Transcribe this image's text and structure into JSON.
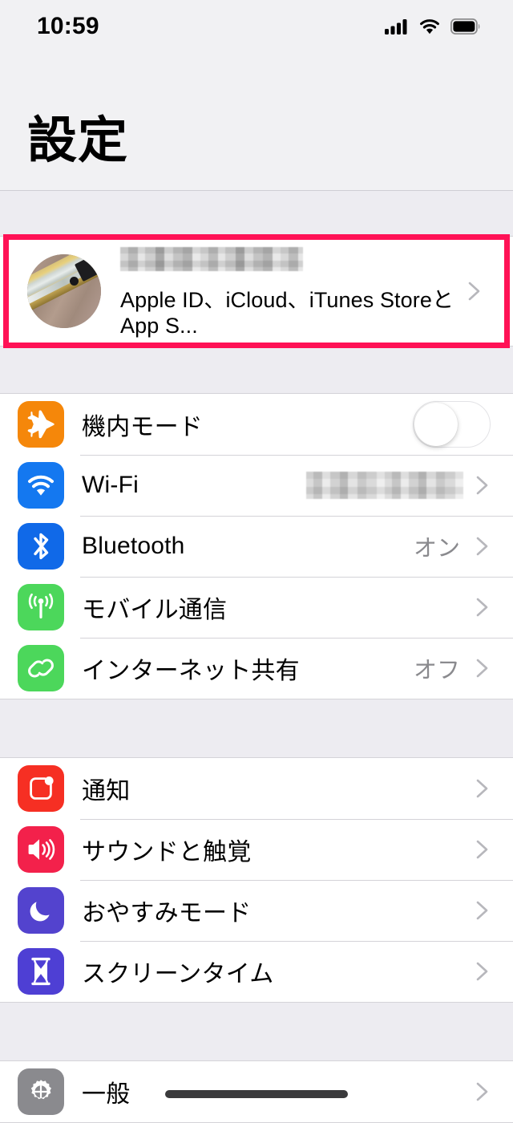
{
  "status_bar": {
    "time": "10:59",
    "cellular_icon": "cellular-bars-icon",
    "wifi_icon": "wifi-icon",
    "battery_icon": "battery-full-icon"
  },
  "header": {
    "title": "設定"
  },
  "account": {
    "name_redacted": true,
    "subtitle": "Apple ID、iCloud、iTunes StoreとApp S...",
    "avatar_icon": "avatar-photo",
    "chevron_icon": "chevron-right-icon",
    "highlight_color": "#FF1256"
  },
  "groups": [
    {
      "name": "connectivity",
      "rows": [
        {
          "label": "機内モード",
          "icon": "airplane-icon",
          "icon_color": "#F5870A",
          "accessory": "toggle",
          "toggle_on": false,
          "value": ""
        },
        {
          "label": "Wi-Fi",
          "icon": "wifi-icon",
          "icon_color": "#1478F0",
          "accessory": "redacted-chevron",
          "value": ""
        },
        {
          "label": "Bluetooth",
          "icon": "bluetooth-icon",
          "icon_color": "#1069E8",
          "accessory": "chevron",
          "value": "オン"
        },
        {
          "label": "モバイル通信",
          "icon": "cellular-antenna-icon",
          "icon_color": "#4CD75B",
          "accessory": "chevron",
          "value": ""
        },
        {
          "label": "インターネット共有",
          "icon": "personal-hotspot-icon",
          "icon_color": "#4CD75B",
          "accessory": "chevron",
          "value": "オフ"
        }
      ]
    },
    {
      "name": "notifications",
      "rows": [
        {
          "label": "通知",
          "icon": "notifications-icon",
          "icon_color": "#F62F23",
          "accessory": "chevron",
          "value": ""
        },
        {
          "label": "サウンドと触覚",
          "icon": "sounds-haptics-icon",
          "icon_color": "#F3214B",
          "accessory": "chevron",
          "value": ""
        },
        {
          "label": "おやすみモード",
          "icon": "do-not-disturb-moon-icon",
          "icon_color": "#5343CE",
          "accessory": "chevron",
          "value": ""
        },
        {
          "label": "スクリーンタイム",
          "icon": "screen-time-hourglass-icon",
          "icon_color": "#4E3FD4",
          "accessory": "chevron",
          "value": ""
        }
      ]
    },
    {
      "name": "general",
      "rows": [
        {
          "label": "一般",
          "icon": "gear-icon",
          "icon_color": "#8A8A8E",
          "accessory": "chevron",
          "value": ""
        }
      ]
    }
  ]
}
